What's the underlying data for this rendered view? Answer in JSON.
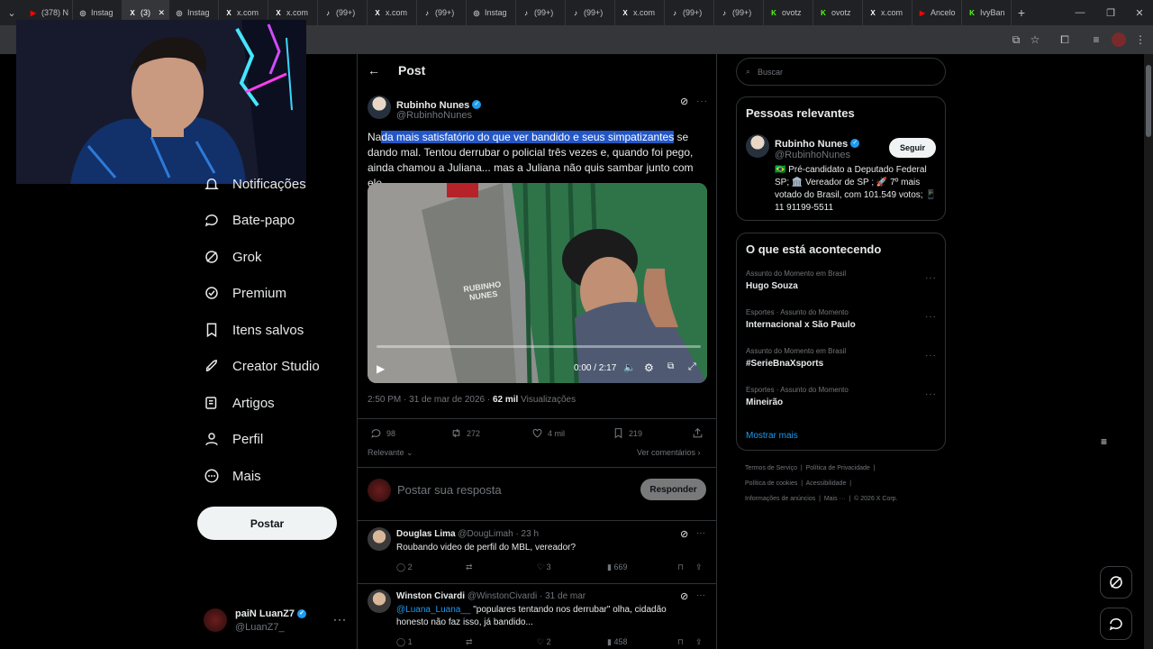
{
  "browser": {
    "tabs": [
      {
        "favicon": "youtube-icon",
        "color": "#ff0000",
        "label": "(378) N"
      },
      {
        "favicon": "instagram-icon",
        "color": "#bdc1c6",
        "label": "Instag"
      },
      {
        "favicon": "x-icon",
        "color": "#ffffff",
        "label": "(3)",
        "active": true
      },
      {
        "favicon": "instagram-icon",
        "color": "#bdc1c6",
        "label": "Instag"
      },
      {
        "favicon": "x-icon",
        "color": "#ffffff",
        "label": "x.com"
      },
      {
        "favicon": "x-icon",
        "color": "#ffffff",
        "label": "x.com"
      },
      {
        "favicon": "tiktok-icon",
        "color": "#ffffff",
        "label": "(99+)"
      },
      {
        "favicon": "x-icon",
        "color": "#ffffff",
        "label": "x.com"
      },
      {
        "favicon": "tiktok-icon",
        "color": "#ffffff",
        "label": "(99+)"
      },
      {
        "favicon": "instagram-icon",
        "color": "#bdc1c6",
        "label": "Instag"
      },
      {
        "favicon": "tiktok-icon",
        "color": "#ffffff",
        "label": "(99+)"
      },
      {
        "favicon": "tiktok-icon",
        "color": "#ffffff",
        "label": "(99+)"
      },
      {
        "favicon": "x-icon",
        "color": "#ffffff",
        "label": "x.com"
      },
      {
        "favicon": "tiktok-icon",
        "color": "#ffffff",
        "label": "(99+)"
      },
      {
        "favicon": "tiktok-icon",
        "color": "#ffffff",
        "label": "(99+)"
      },
      {
        "favicon": "kick-icon",
        "color": "#53fc18",
        "label": "ovotz"
      },
      {
        "favicon": "kick-icon",
        "color": "#53fc18",
        "label": "ovotz"
      },
      {
        "favicon": "x-icon",
        "color": "#ffffff",
        "label": "x.com"
      },
      {
        "favicon": "youtube-icon",
        "color": "#ff0000",
        "label": "Ancelo"
      },
      {
        "favicon": "kick-icon",
        "color": "#53fc18",
        "label": "IvyBan"
      }
    ]
  },
  "nav": {
    "items": [
      {
        "label": "Notificações",
        "icon": "bell-icon"
      },
      {
        "label": "Bate-papo",
        "icon": "chat-icon"
      },
      {
        "label": "Grok",
        "icon": "grok-icon"
      },
      {
        "label": "Premium",
        "icon": "premium-icon"
      },
      {
        "label": "Itens salvos",
        "icon": "bookmark-icon"
      },
      {
        "label": "Creator Studio",
        "icon": "rocket-icon"
      },
      {
        "label": "Artigos",
        "icon": "article-icon"
      },
      {
        "label": "Perfil",
        "icon": "person-icon"
      },
      {
        "label": "Mais",
        "icon": "more-circle-icon"
      }
    ],
    "post_button": "Postar",
    "account": {
      "name": "paiN LuanZ7",
      "handle": "@LuanZ7_"
    }
  },
  "post": {
    "header": "Post",
    "author": {
      "name": "Rubinho Nunes",
      "handle": "@RubinhoNunes"
    },
    "text_pre": "Na",
    "text_highlight": "da mais satisfatório do que ver bandido e seus simpatizantes",
    "text_post": " se dando mal. Tentou derrubar o policial três vezes e, quando foi pego, ainda chamou a Juliana... mas a Juliana não quis sambar junto com ele.",
    "video": {
      "watermark": "RUBINHO NUNES",
      "time": "0:00 / 2:17"
    },
    "timestamp": "2:50 PM · 31 de mar de 2026 · ",
    "views_count": "62 mil",
    "views_label": " Visualizações",
    "stats": {
      "replies": "98",
      "reposts": "272",
      "likes": "4 mil",
      "bookmarks": "219"
    },
    "sort_label": "Relevante",
    "view_comments": "Ver comentários",
    "reply_placeholder": "Postar sua resposta",
    "reply_button": "Responder"
  },
  "comments": [
    {
      "name": "Douglas Lima",
      "handle": "@DougLimah",
      "time": " · 23 h",
      "mention": "",
      "text": "Roubando video de perfil do MBL, vereador?",
      "replies": "2",
      "reposts": "",
      "likes": "3",
      "views": "669"
    },
    {
      "name": "Winston Civardi",
      "handle": "@WinstonCivardi",
      "time": " · 31 de mar",
      "mention": "@Luana_Luana__",
      "text": " \"populares tentando nos derrubar\" olha, cidadão honesto não faz isso, já bandido...",
      "replies": "1",
      "reposts": "",
      "likes": "2",
      "views": "458"
    }
  ],
  "sidebar": {
    "search_placeholder": "Buscar",
    "relevant": {
      "title": "Pessoas relevantes",
      "name": "Rubinho Nunes",
      "handle": "@RubinhoNunes",
      "follow": "Seguir",
      "bio": "🇧🇷 Pré-candidato a Deputado Federal SP; 🏛️ Vereador de SP ; 🚀 7º mais votado do Brasil, com 101.549 votos; 📱 11 91199-5511"
    },
    "trends_title": "O que está acontecendo",
    "trends": [
      {
        "category": "Assunto do Momento em Brasil",
        "name": "Hugo Souza"
      },
      {
        "category": "Esportes · Assunto do Momento",
        "name": "Internacional x São Paulo"
      },
      {
        "category": "Assunto do Momento em Brasil",
        "name": "#SerieBnaXsports"
      },
      {
        "category": "Esportes · Assunto do Momento",
        "name": "Mineirão"
      }
    ],
    "show_more": "Mostrar mais",
    "footer_line1": [
      "Termos de Serviço",
      "Política de Privacidade"
    ],
    "footer_line2": [
      "Política de cookies",
      "Acessibilidade"
    ],
    "footer_line3": [
      "Informações de anúncios",
      "Mais ···",
      "© 2026 X Corp."
    ]
  },
  "colors": {
    "accent": "#1d9bf0",
    "highlight": "#2457c5",
    "bg": "#000000"
  }
}
